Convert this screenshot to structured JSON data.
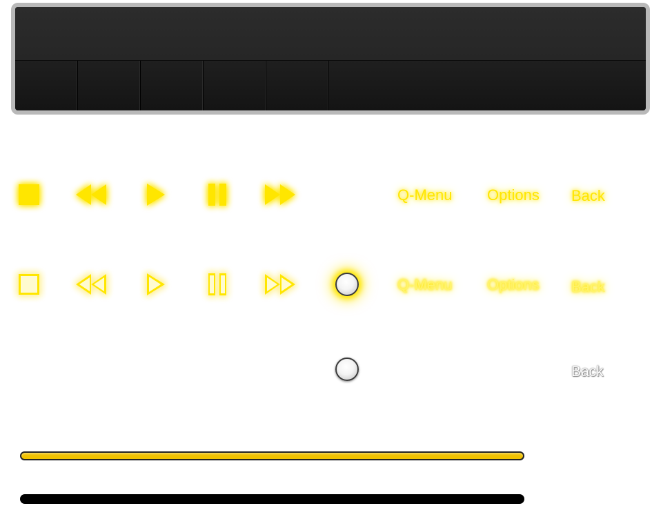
{
  "panel": {
    "slots": [
      "",
      "",
      "",
      "",
      "",
      ""
    ]
  },
  "glow_row": {
    "icons": [
      "stop-icon",
      "rewind-icon",
      "play-icon",
      "pause-icon",
      "fast-forward-icon"
    ],
    "qmenu_label": "Q-Menu",
    "options_label": "Options",
    "back_label": "Back"
  },
  "pressed_row": {
    "icons": [
      "stop-icon",
      "rewind-icon",
      "play-icon",
      "pause-icon",
      "fast-forward-icon"
    ],
    "qmenu_label": "Q-Menu",
    "options_label": "Options",
    "back_label": "Back"
  },
  "plain_row": {
    "back_label": "Back"
  },
  "colors": {
    "accent_yellow": "#ffe600",
    "progress_fill": "#f1c200",
    "panel_bg": "#1a1a1a",
    "panel_border": "#b9b9b9",
    "track_black": "#000000"
  },
  "progress": {
    "yellow_fill_fraction": 1.0,
    "black_fill_fraction": 0.0
  }
}
